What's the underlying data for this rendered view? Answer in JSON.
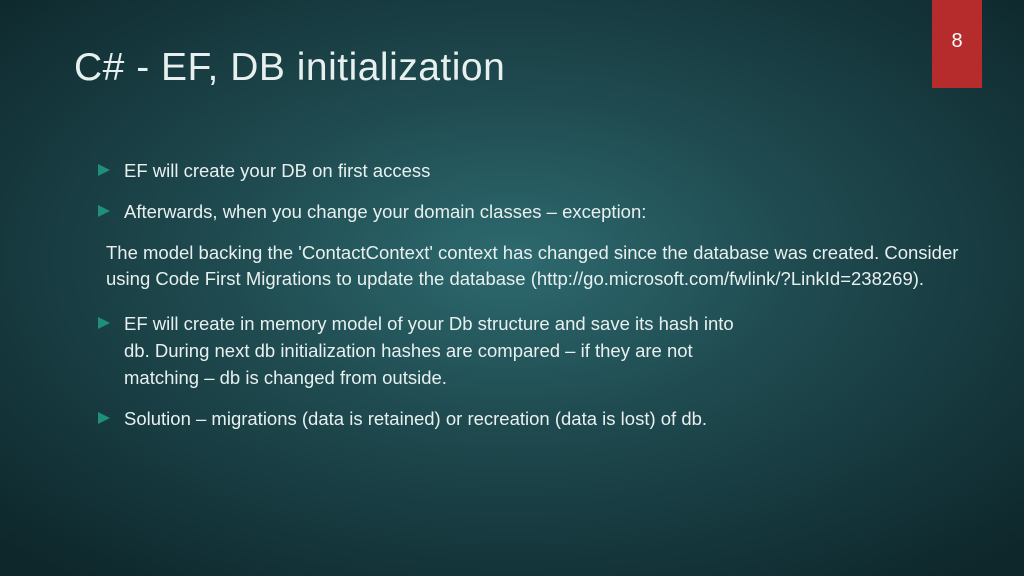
{
  "pageNumber": "8",
  "title": "C# - EF, DB initialization",
  "bullets": {
    "b1": "EF will create your DB on first access",
    "b2": "Afterwards, when you change your domain classes – exception:",
    "sub": "The model backing the 'ContactContext' context has changed since the database was created. Consider using Code First Migrations to update the database (http://go.microsoft.com/fwlink/?LinkId=238269).",
    "b3": "EF will create in memory model of your Db structure and save its hash into db. During next db initialization hashes are compared – if they are not matching – db is changed from outside.",
    "b4": "Solution – migrations (data is retained) or recreation (data is lost) of db."
  },
  "accentColor": "#1f8f7a"
}
